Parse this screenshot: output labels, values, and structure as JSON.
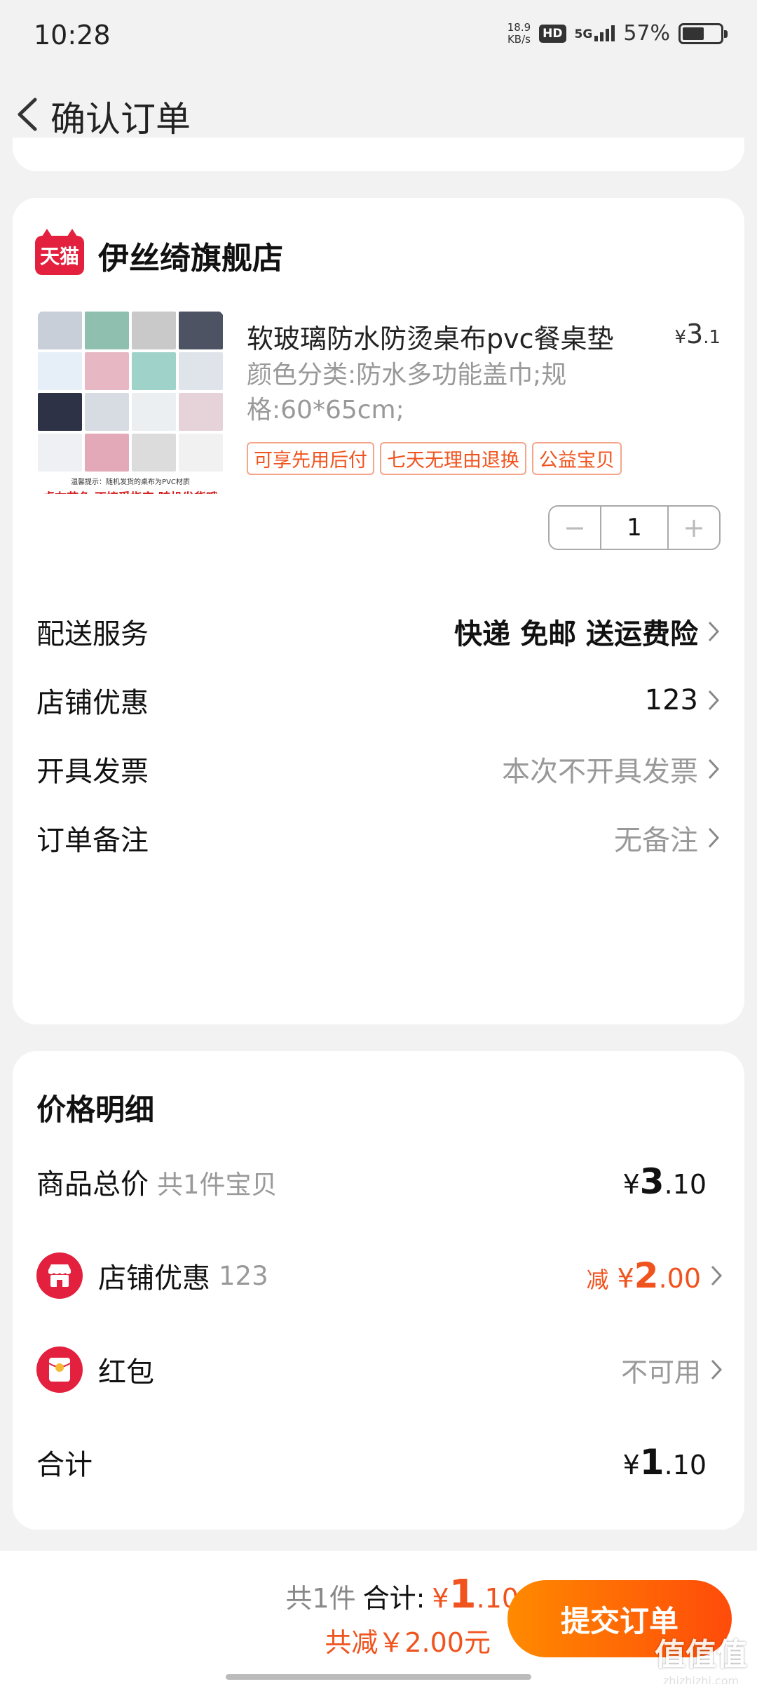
{
  "status": {
    "time": "10:28",
    "speed_top": "18.9",
    "speed_bottom": "KB/s",
    "hd": "HD",
    "network": "5G",
    "battery_pct": "57%",
    "battery_level": 0.57
  },
  "header": {
    "title": "确认订单"
  },
  "store": {
    "badge": "天猫",
    "name": "伊丝绮旗舰店"
  },
  "product": {
    "title": "软玻璃防水防烫桌布pvc餐桌垫",
    "price_symbol": "¥",
    "price_int": "3",
    "price_dec": ".1",
    "spec": "颜色分类:防水多功能盖巾;规格:60*65cm;",
    "tags": [
      "可享先用后付",
      "七天无理由退换",
      "公益宝贝"
    ],
    "image_note": "温馨提示：随机发货的桌布为PVC材质",
    "image_warning": "桌布花色  不接受指定 随机发货哦",
    "quantity": "1",
    "minus": "−",
    "plus": "+"
  },
  "options": [
    {
      "label": "配送服务",
      "value": "快递 免邮 送运费险"
    },
    {
      "label": "店铺优惠",
      "value": "123"
    },
    {
      "label": "开具发票",
      "value": "本次不开具发票"
    },
    {
      "label": "订单备注",
      "value": "无备注"
    }
  ],
  "price_detail": {
    "title": "价格明细",
    "goods_total_label": "商品总价",
    "goods_total_sub": "共1件宝贝",
    "goods_total_sym": "¥",
    "goods_total_int": "3",
    "goods_total_dec": ".10",
    "store_discount_label": "店铺优惠",
    "store_discount_sub": "123",
    "store_discount_prefix": "减",
    "store_discount_sym": "¥",
    "store_discount_int": "2",
    "store_discount_dec": ".00",
    "redpacket_label": "红包",
    "redpacket_value": "不可用",
    "total_label": "合计",
    "total_sym": "¥",
    "total_int": "1",
    "total_dec": ".10"
  },
  "bottom": {
    "count": "共1件",
    "sum_label": "合计:",
    "sum_sym": "¥",
    "sum_int": "1",
    "sum_dec": ".10",
    "saved": "共减￥2.00元",
    "submit": "提交订单"
  },
  "watermark": {
    "main": "值值值",
    "url": "zhizhizhi.com"
  },
  "colors": {
    "accent": "#f0531e",
    "tmall": "#e3213f",
    "submit_start": "#ff8a00",
    "submit_end": "#ff4b0a"
  }
}
